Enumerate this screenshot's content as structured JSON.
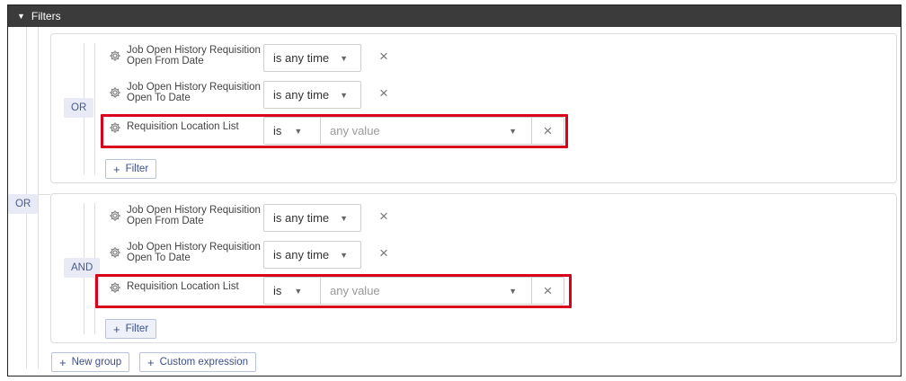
{
  "header": {
    "title": "Filters",
    "caret_icon": "caret-down-icon"
  },
  "root_operator": "OR",
  "groups": [
    {
      "operator": "OR",
      "rows": [
        {
          "field": "Job Open History Requisition Open From Date",
          "operator": "is any time"
        },
        {
          "field": "Job Open History Requisition Open To Date",
          "operator": "is any time"
        }
      ],
      "location_row": {
        "field": "Requisition Location List",
        "operator": "is",
        "value_placeholder": "any value"
      },
      "add_filter_label": "Filter"
    },
    {
      "operator": "AND",
      "rows": [
        {
          "field": "Job Open History Requisition Open From Date",
          "operator": "is any time"
        },
        {
          "field": "Job Open History Requisition Open To Date",
          "operator": "is any time"
        }
      ],
      "location_row": {
        "field": "Requisition Location List",
        "operator": "is",
        "value_placeholder": "any value"
      },
      "add_filter_label": "Filter"
    }
  ],
  "footer": {
    "new_group_label": "New group",
    "custom_expression_label": "Custom expression"
  },
  "colors": {
    "header_bg": "#3b3b3b",
    "highlight": "#d9001b",
    "accent": "#3d4f8a",
    "badge_bg": "#e8ebf5"
  }
}
